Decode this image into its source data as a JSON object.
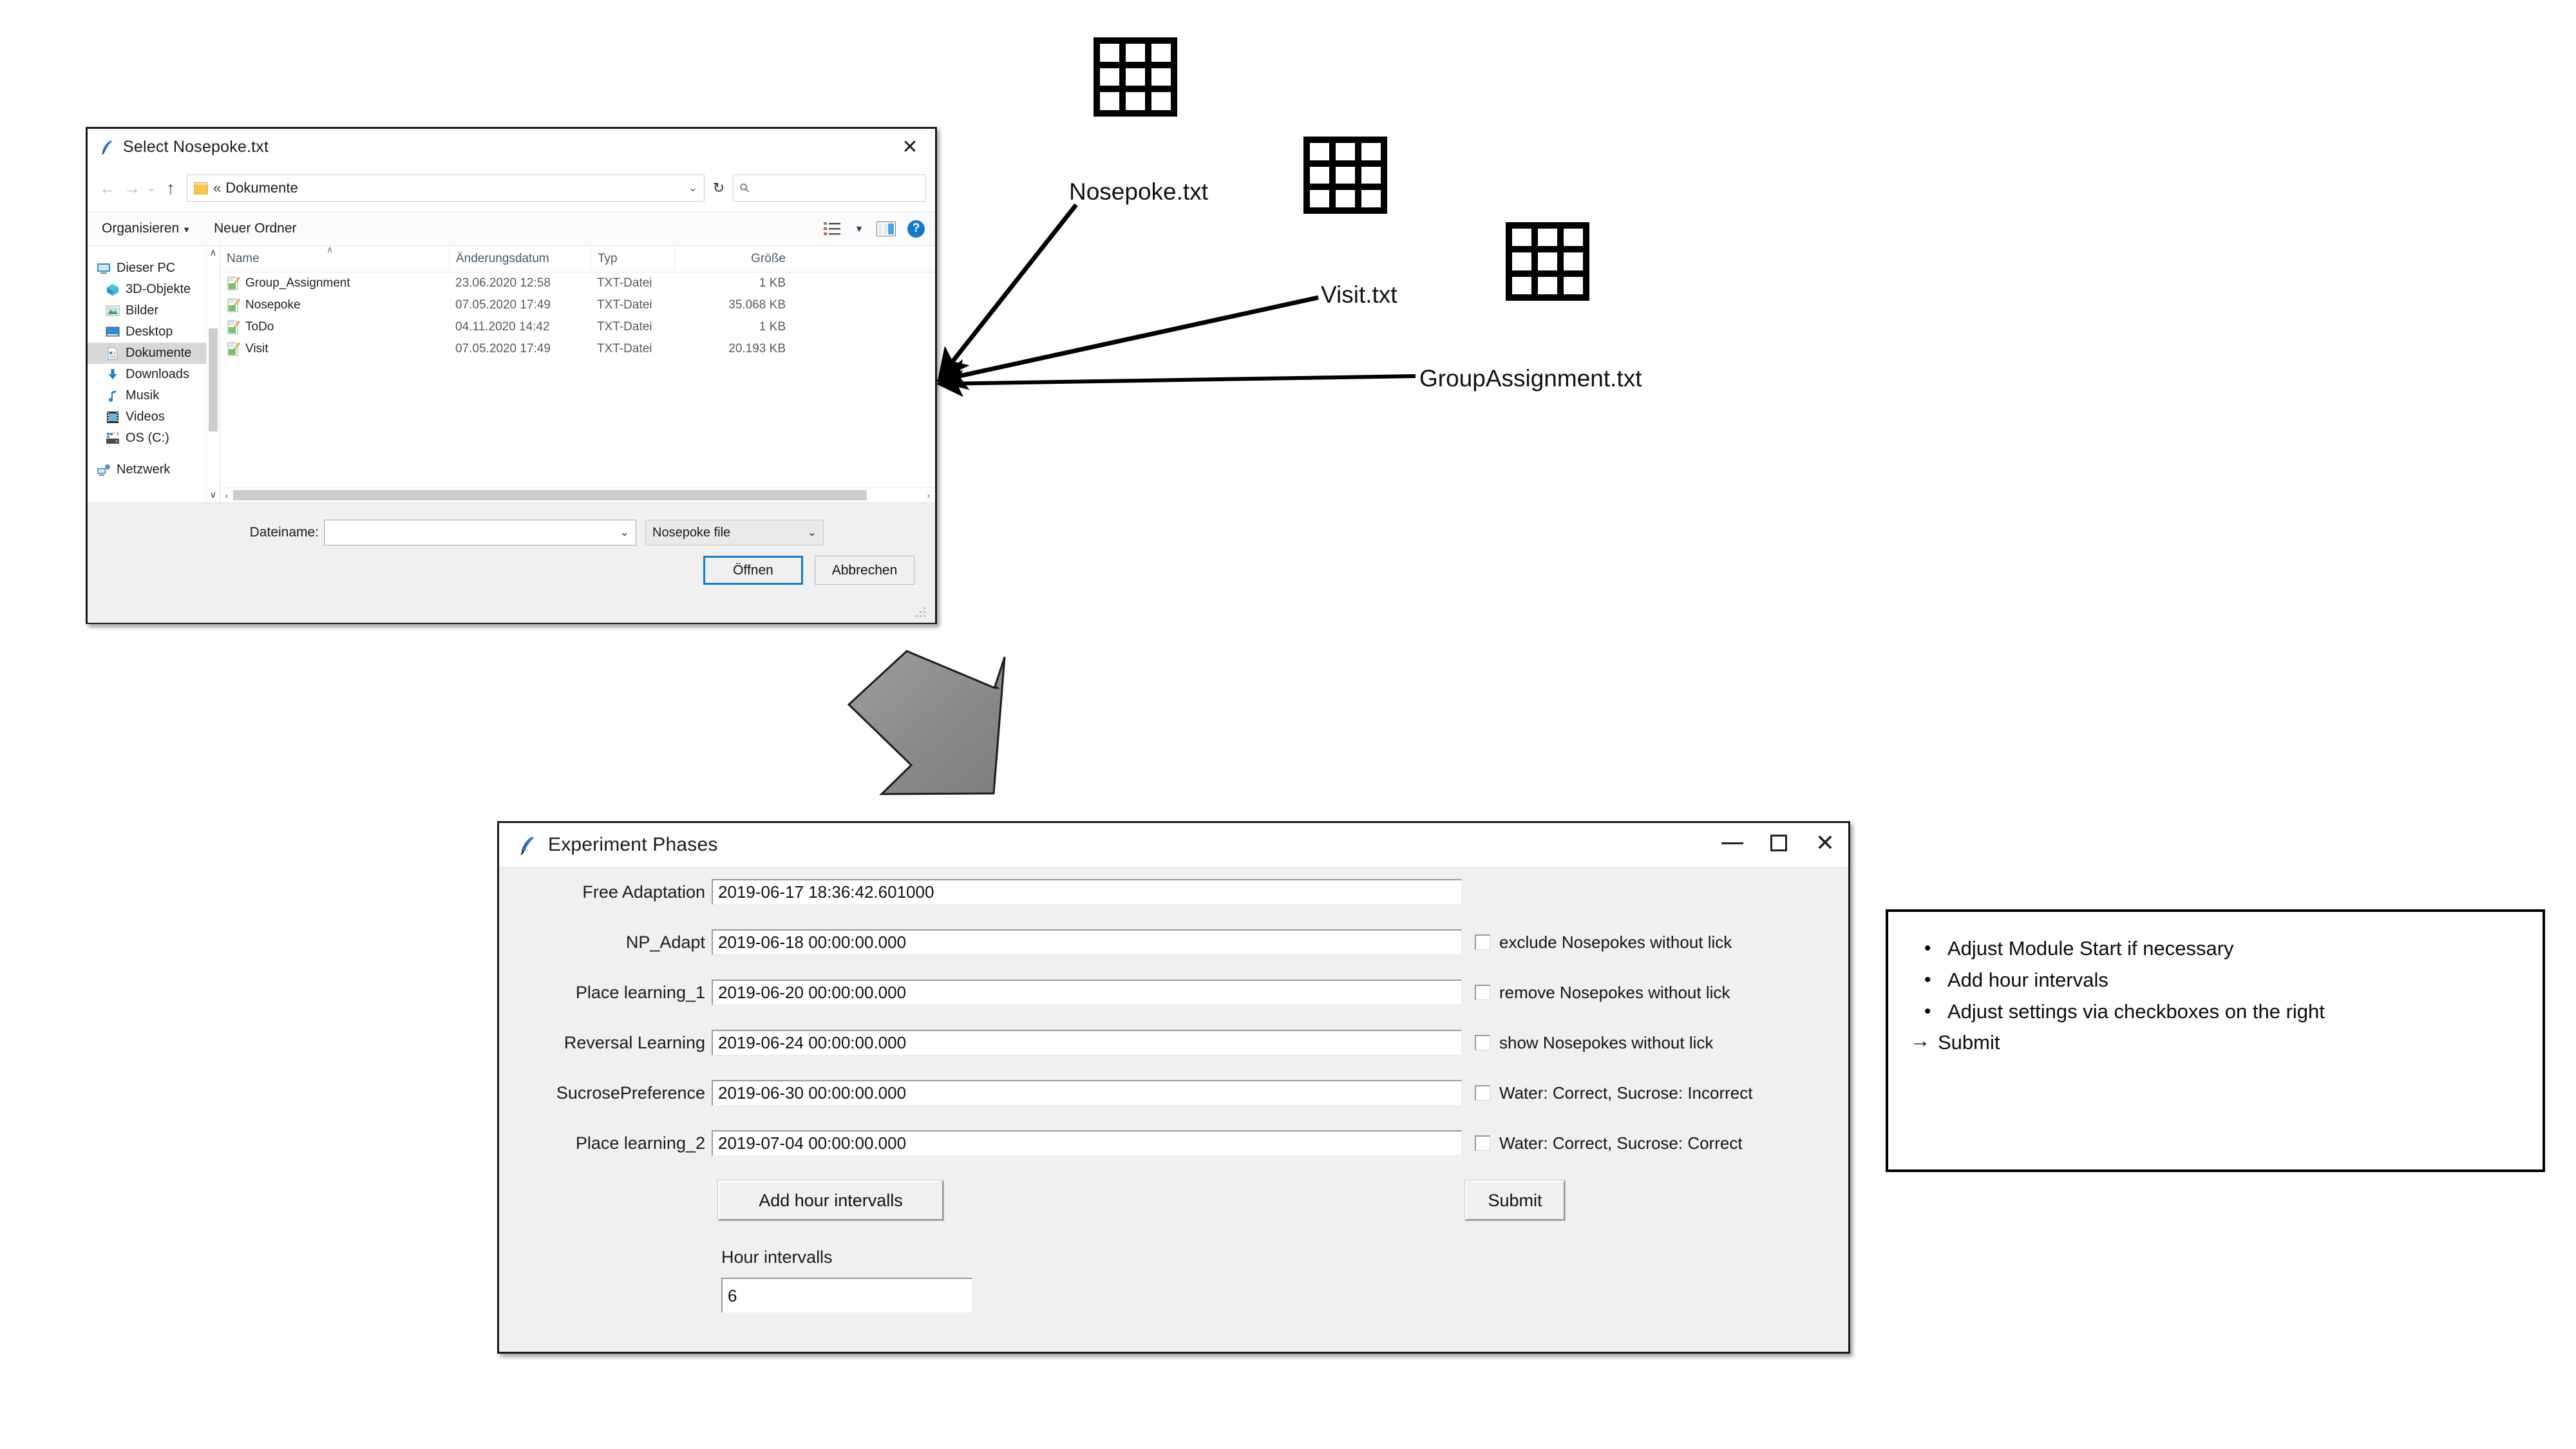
{
  "file_dialog": {
    "title": "Select Nosepoke.txt",
    "close_icon": "✕",
    "nav": {
      "back_icon": "←",
      "forward_icon": "→",
      "recent_caret_icon": "⌄",
      "up_icon": "↑",
      "address_separator": "«",
      "address_text": "Dokumente",
      "address_caret_icon": "⌄",
      "refresh_icon": "↻",
      "search_icon": "⚲",
      "search_placeholder": ""
    },
    "toolbar": {
      "organize_label": "Organisieren",
      "organize_caret": "▼",
      "new_folder_label": "Neuer Ordner",
      "view_caret": "▼",
      "help_label": "?"
    },
    "sidebar": {
      "items": [
        {
          "label": "Dieser PC",
          "icon": "monitor-icon",
          "selected": false,
          "root": true
        },
        {
          "label": "3D-Objekte",
          "icon": "cube-icon",
          "selected": false
        },
        {
          "label": "Bilder",
          "icon": "picture-icon",
          "selected": false
        },
        {
          "label": "Desktop",
          "icon": "desktop-icon",
          "selected": false
        },
        {
          "label": "Dokumente",
          "icon": "document-icon",
          "selected": true
        },
        {
          "label": "Downloads",
          "icon": "download-icon",
          "selected": false
        },
        {
          "label": "Musik",
          "icon": "music-icon",
          "selected": false
        },
        {
          "label": "Videos",
          "icon": "video-icon",
          "selected": false
        },
        {
          "label": "OS (C:)",
          "icon": "drive-icon",
          "selected": false
        },
        {
          "label": "Netzwerk",
          "icon": "network-icon",
          "selected": false,
          "spaced": true
        }
      ],
      "scroll_up_icon": "∧",
      "scroll_down_icon": "∨"
    },
    "list": {
      "columns": [
        "Name",
        "Änderungsdatum",
        "Typ",
        "Größe"
      ],
      "sort_caret": "∧",
      "rows": [
        {
          "name": "Group_Assignment",
          "date": "23.06.2020 12:58",
          "type": "TXT-Datei",
          "size": "1 KB"
        },
        {
          "name": "Nosepoke",
          "date": "07.05.2020 17:49",
          "type": "TXT-Datei",
          "size": "35.068 KB"
        },
        {
          "name": "ToDo",
          "date": "04.11.2020 14:42",
          "type": "TXT-Datei",
          "size": "1 KB"
        },
        {
          "name": "Visit",
          "date": "07.05.2020 17:49",
          "type": "TXT-Datei",
          "size": "20.193 KB"
        }
      ],
      "hscroll_left_icon": "‹",
      "hscroll_right_icon": "›"
    },
    "footer": {
      "filename_label": "Dateiname:",
      "filename_value": "",
      "filename_caret": "⌄",
      "filetype_value": "Nosepoke file",
      "filetype_caret": "⌄",
      "open_button": "Öffnen",
      "cancel_button": "Abbrechen"
    }
  },
  "files_diagram": {
    "sheets": [
      {
        "label": "Nosepoke.txt"
      },
      {
        "label": "Visit.txt"
      },
      {
        "label": "GroupAssignment.txt"
      }
    ]
  },
  "exp_window": {
    "title": "Experiment Phases",
    "minimize_icon": "–",
    "maximize_icon": "☐",
    "close_icon": "✕",
    "phases": [
      {
        "label": "Free Adaptation",
        "value": "2019-06-17 18:36:42.601000"
      },
      {
        "label": "NP_Adapt",
        "value": "2019-06-18 00:00:00.000"
      },
      {
        "label": "Place learning_1",
        "value": "2019-06-20 00:00:00.000"
      },
      {
        "label": "Reversal Learning",
        "value": "2019-06-24 00:00:00.000"
      },
      {
        "label": "SucrosePreference",
        "value": "2019-06-30 00:00:00.000"
      },
      {
        "label": "Place learning_2",
        "value": "2019-07-04 00:00:00.000"
      }
    ],
    "checkboxes": [
      {
        "label": "exclude Nosepokes without lick",
        "checked": false
      },
      {
        "label": "remove Nosepokes without lick",
        "checked": false
      },
      {
        "label": "show Nosepokes without lick",
        "checked": false
      },
      {
        "label": "Water: Correct, Sucrose: Incorrect",
        "checked": false
      },
      {
        "label": "Water: Correct, Sucrose: Correct",
        "checked": false
      }
    ],
    "add_hour_button": "Add hour intervalls",
    "submit_button": "Submit",
    "hour_label": "Hour intervalls",
    "hour_value": "6"
  },
  "instructions": {
    "bullet": "•",
    "items": [
      "Adjust Module Start if necessary",
      "Add hour intervals",
      "Adjust settings via checkboxes on the right"
    ],
    "arrow_icon": "→",
    "final": "Submit"
  }
}
